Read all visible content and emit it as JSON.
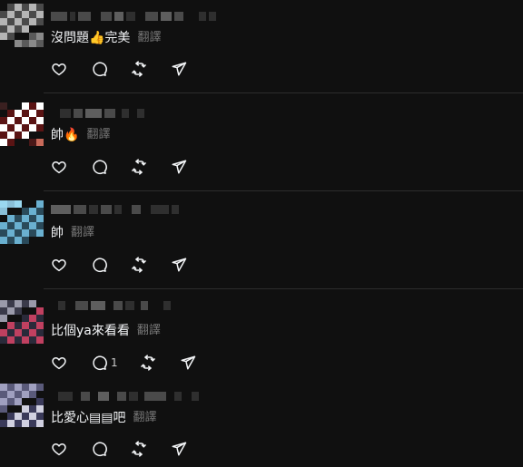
{
  "comments": [
    {
      "text": "沒問題👍完美",
      "translate": "翻譯",
      "reply_count": ""
    },
    {
      "text": "帥🔥",
      "translate": "翻譯",
      "reply_count": ""
    },
    {
      "text": "帥",
      "translate": "翻譯",
      "reply_count": ""
    },
    {
      "text": "比個ya來看看",
      "translate": "翻譯",
      "reply_count": "1"
    },
    {
      "text": "比愛心▤▤吧",
      "translate": "翻譯",
      "reply_count": ""
    }
  ],
  "icons": {
    "like": "heart-icon",
    "reply": "comment-icon",
    "repost": "repost-icon",
    "share": "send-icon"
  },
  "colors": {
    "background": "#101010",
    "text": "#f3f5f7",
    "secondary_text": "#777777",
    "divider": "#2d2d2d"
  }
}
